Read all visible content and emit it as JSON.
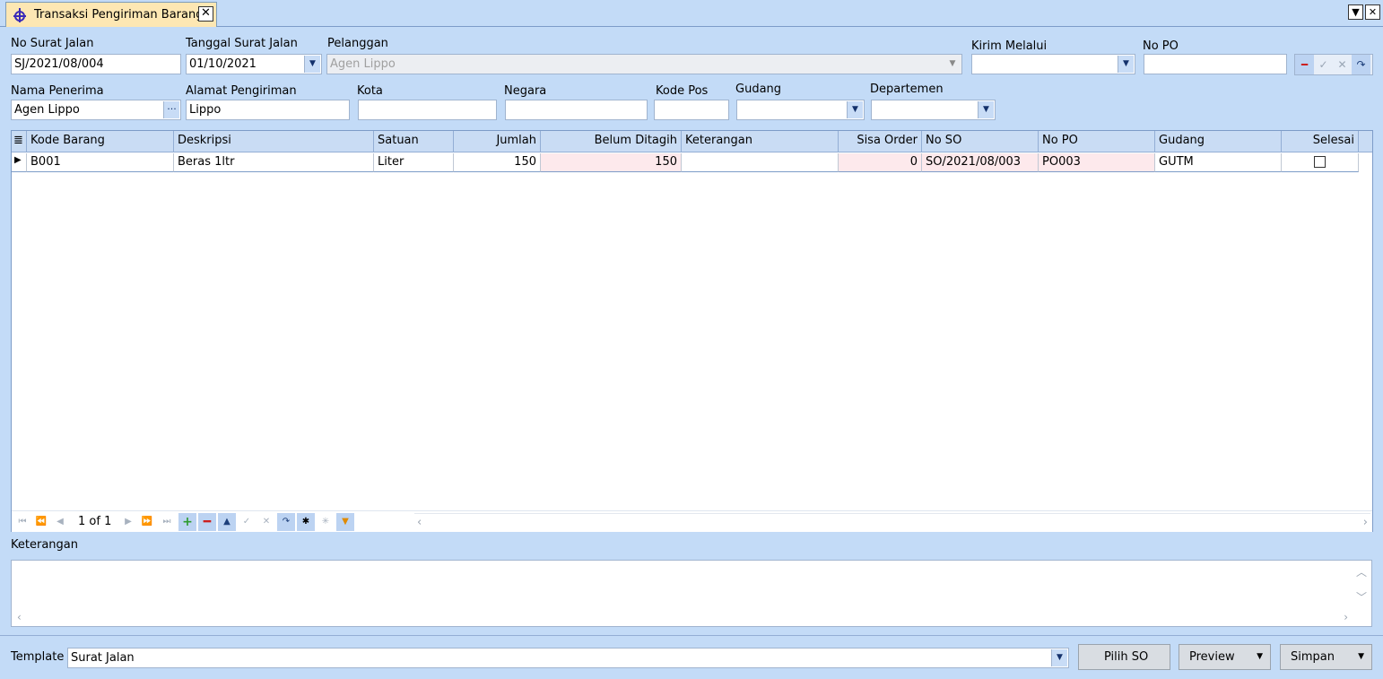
{
  "tab": {
    "title": "Transaksi Pengiriman Barang",
    "close": "✕"
  },
  "window": {
    "menu_btn": "▼",
    "close_btn": "✕"
  },
  "header": {
    "no_surat_jalan": {
      "label": "No Surat Jalan",
      "value": "SJ/2021/08/004"
    },
    "tanggal_surat_jalan": {
      "label": "Tanggal Surat Jalan",
      "value": "01/10/2021"
    },
    "pelanggan": {
      "label": "Pelanggan",
      "value": "Agen Lippo"
    },
    "kirim_melalui": {
      "label": "Kirim Melalui",
      "value": ""
    },
    "no_po": {
      "label": "No PO",
      "value": ""
    },
    "nama_penerima": {
      "label": "Nama Penerima",
      "value": "Agen Lippo",
      "browse": "···"
    },
    "alamat_pengiriman": {
      "label": "Alamat Pengiriman",
      "value": "Lippo"
    },
    "kota": {
      "label": "Kota",
      "value": ""
    },
    "negara": {
      "label": "Negara",
      "value": ""
    },
    "kode_pos": {
      "label": "Kode Pos",
      "value": ""
    },
    "gudang": {
      "label": "Gudang",
      "value": ""
    },
    "departemen": {
      "label": "Departemen",
      "value": ""
    }
  },
  "grid": {
    "columns": [
      "Kode Barang",
      "Deskripsi",
      "Satuan",
      "Jumlah",
      "Belum Ditagih",
      "Keterangan",
      "Sisa Order",
      "No SO",
      "No PO",
      "Gudang",
      "Selesai"
    ],
    "rows": [
      {
        "kode_barang": "B001",
        "deskripsi": "Beras 1ltr",
        "satuan": "Liter",
        "jumlah": "150",
        "belum_ditagih": "150",
        "keterangan": "",
        "sisa_order": "0",
        "no_so": "SO/2021/08/003",
        "no_po": "PO003",
        "gudang": "GUTM",
        "selesai": false
      }
    ],
    "pager": "1 of 1"
  },
  "keterangan": {
    "label": "Keterangan",
    "value": ""
  },
  "footer": {
    "template_label": "Template",
    "template_value": "Surat Jalan",
    "pilih_so": "Pilih SO",
    "preview": "Preview",
    "simpan": "Simpan"
  },
  "colors": {
    "background": "#c3dbf7",
    "tab_active": "#fde7b3",
    "pink_cell": "#fde9ec",
    "header": "#c9dcf4"
  }
}
